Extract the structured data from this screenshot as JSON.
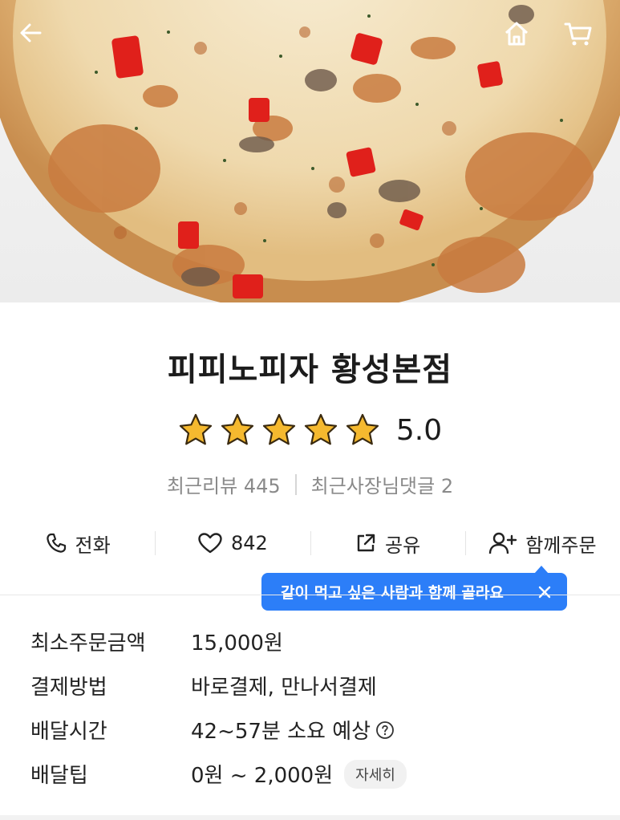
{
  "header": {
    "back_icon": "arrow-left-icon",
    "home_icon": "home-icon",
    "cart_icon": "cart-icon",
    "hero_image": "pizza-photo"
  },
  "store": {
    "name": "피피노피자 황성본점",
    "rating": "5.0",
    "stars": 5,
    "star_color": "#f5b92f",
    "recent_reviews": "최근리뷰 445",
    "recent_owner_comments": "최근사장님댓글 2"
  },
  "actions": [
    {
      "icon": "phone-icon",
      "label": "전화"
    },
    {
      "icon": "heart-icon",
      "label": "842"
    },
    {
      "icon": "share-icon",
      "label": "공유"
    },
    {
      "icon": "add-person-icon",
      "label": "함께주문"
    }
  ],
  "tooltip": {
    "text": "같이 먹고 싶은 사람과 함께 골라요",
    "color": "#2c7ef8"
  },
  "info": {
    "min_order_label": "최소주문금액",
    "min_order_value": "15,000원",
    "payment_label": "결제방법",
    "payment_value": "바로결제, 만나서결제",
    "delivery_time_label": "배달시간",
    "delivery_time_value": "42~57분 소요 예상",
    "delivery_tip_label": "배달팁",
    "delivery_tip_value": "0원 ~ 2,000원",
    "detail_button": "자세히"
  }
}
